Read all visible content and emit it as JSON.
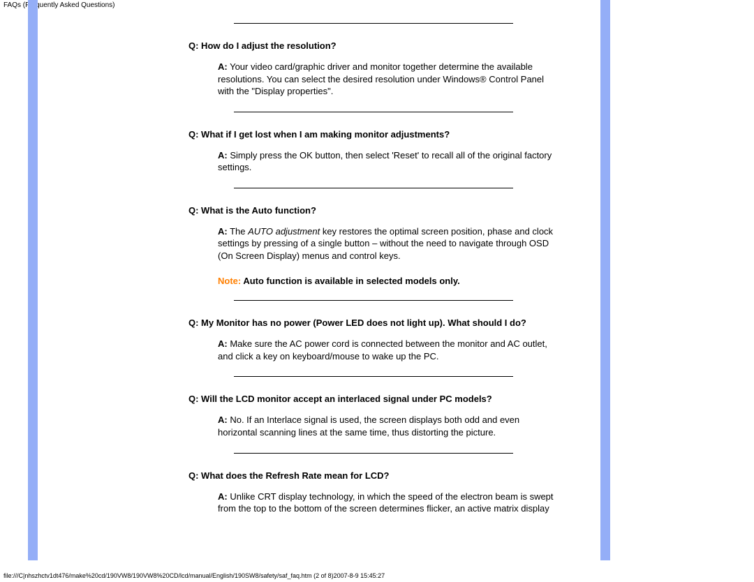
{
  "header": "FAQs (Frequently Asked Questions)",
  "faqs": [
    {
      "q": "Q: How do I adjust the resolution?",
      "a_label": "A:",
      "a": " Your video card/graphic driver and monitor together determine the available resolutions. You can select the desired resolution under Windows® Control Panel with the \"Display properties\"."
    },
    {
      "q": "Q: What if I get lost when I am making monitor adjustments?",
      "a_label": "A:",
      "a": " Simply press the OK button, then select 'Reset' to recall all of the original factory settings."
    },
    {
      "q": "Q: What is the Auto function?",
      "a_label": "A:",
      "a_pre": " The ",
      "a_italic": "AUTO adjustment",
      "a_post": " key restores the optimal screen position, phase and clock settings by pressing of a single button – without the need to navigate through OSD (On Screen Display) menus and control keys.",
      "note_label": "Note:",
      "note": " Auto function is available in selected models only."
    },
    {
      "q": "Q: My Monitor has no power (Power LED does not light up). What should I do?",
      "a_label": "A:",
      "a": " Make sure the AC power cord is connected between the monitor and AC outlet, and click a key on keyboard/mouse to wake up the PC."
    },
    {
      "q": "Q: Will the LCD monitor accept an interlaced signal under PC models?",
      "a_label": "A:",
      "a": " No. If an Interlace signal is used, the screen displays both odd and even horizontal scanning lines at the same time, thus distorting the picture."
    },
    {
      "q": "Q: What does the Refresh Rate mean for LCD?",
      "a_label": "A:",
      "a": " Unlike CRT display technology, in which the speed of the electron beam is swept from the top to the bottom of the screen determines flicker, an active matrix display"
    }
  ],
  "footer": "file:///C|nhszhctv1dt476/make%20cd/190VW8/190VW8%20CD/lcd/manual/English/190SW8/safety/saf_faq.htm (2 of 8)2007-8-9 15:45:27"
}
